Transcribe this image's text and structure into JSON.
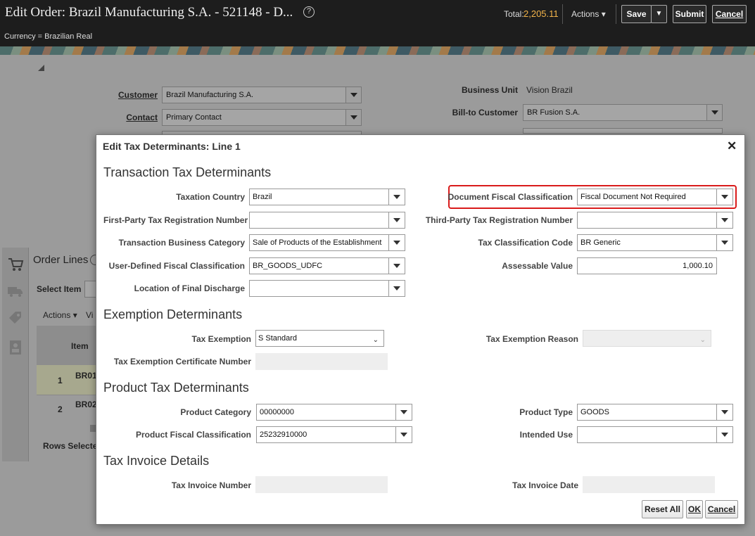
{
  "header": {
    "title": "Edit Order: Brazil Manufacturing S.A. - 521148 - D...",
    "currency": "Currency = Brazilian Real",
    "total_label": "Total:",
    "total_value": "2,205.11",
    "actions_label": "Actions",
    "save_label": "Save",
    "submit_label": "Submit",
    "cancel_label": "Cancel"
  },
  "background": {
    "customer_label": "Customer",
    "customer_value": "Brazil Manufacturing S.A.",
    "contact_label": "Contact",
    "contact_value": "Primary Contact",
    "business_unit_label": "Business Unit",
    "business_unit_value": "Vision Brazil",
    "bill_to_customer_label": "Bill-to Customer",
    "bill_to_customer_value": "BR Fusion S.A.",
    "order_lines_title": "Order Lines",
    "select_item_label": "Select Item",
    "actions_label": "Actions",
    "view_label": "Vi",
    "item_header": "Item",
    "rows": [
      {
        "num": "1",
        "item": "BR01"
      },
      {
        "num": "2",
        "item": "BR02"
      }
    ],
    "rows_selected_label": "Rows Selecte"
  },
  "modal": {
    "title": "Edit Tax Determinants: Line 1",
    "sections": {
      "transaction": "Transaction Tax Determinants",
      "exemption": "Exemption Determinants",
      "product": "Product Tax Determinants",
      "invoice": "Tax Invoice Details"
    },
    "fields": {
      "taxation_country": {
        "label": "Taxation Country",
        "value": "Brazil"
      },
      "first_party": {
        "label": "First-Party Tax Registration Number",
        "value": ""
      },
      "transaction_business_category": {
        "label": "Transaction Business Category",
        "value": "Sale of Products of the Establishment"
      },
      "user_defined_fiscal": {
        "label": "User-Defined Fiscal Classification",
        "value": "BR_GOODS_UDFC"
      },
      "location_final_discharge": {
        "label": "Location of Final Discharge",
        "value": ""
      },
      "document_fiscal": {
        "label": "Document Fiscal Classification",
        "value": "Fiscal Document Not Required"
      },
      "third_party": {
        "label": "Third-Party Tax Registration Number",
        "value": ""
      },
      "tax_classification_code": {
        "label": "Tax Classification Code",
        "value": "BR Generic"
      },
      "assessable_value": {
        "label": "Assessable Value",
        "value": "1,000.10"
      },
      "tax_exemption": {
        "label": "Tax Exemption",
        "value": "S Standard"
      },
      "tax_exemption_reason": {
        "label": "Tax Exemption Reason",
        "value": ""
      },
      "tax_exemption_cert": {
        "label": "Tax Exemption Certificate Number",
        "value": ""
      },
      "product_category": {
        "label": "Product Category",
        "value": "00000000"
      },
      "product_fiscal": {
        "label": "Product Fiscal Classification",
        "value": "25232910000"
      },
      "product_type": {
        "label": "Product Type",
        "value": "GOODS"
      },
      "intended_use": {
        "label": "Intended Use",
        "value": ""
      },
      "tax_invoice_number": {
        "label": "Tax Invoice Number",
        "value": ""
      },
      "tax_invoice_date": {
        "label": "Tax Invoice Date",
        "value": ""
      }
    },
    "buttons": {
      "reset_all": "Reset All",
      "ok": "OK",
      "cancel": "Cancel"
    }
  }
}
